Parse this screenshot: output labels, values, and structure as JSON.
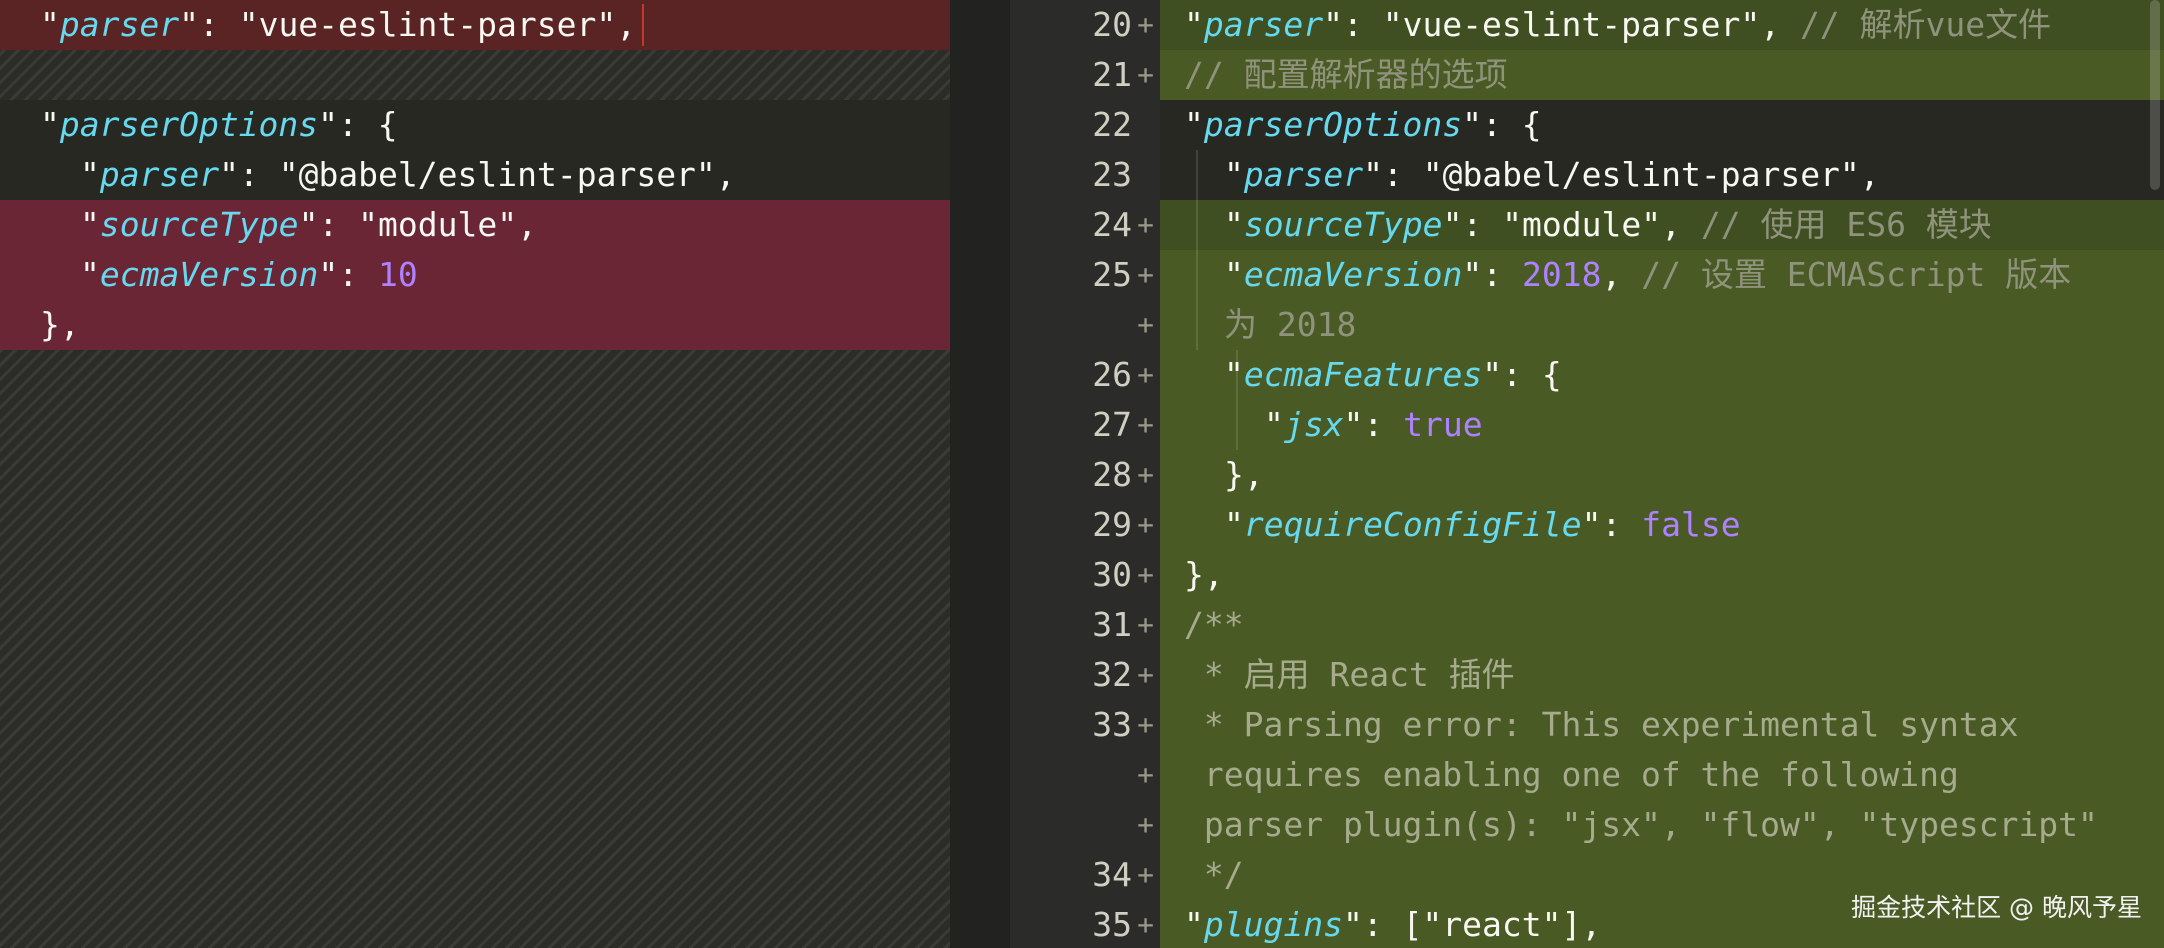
{
  "left": {
    "lines": [
      {
        "key": "parser",
        "value": "\"vue-eslint-parser\","
      },
      {
        "key": "parserOptions",
        "value": ": {"
      },
      {
        "key": "parser",
        "value": "\"@babel/eslint-parser\","
      },
      {
        "key": "sourceType",
        "value": "\"module\","
      },
      {
        "key": "ecmaVersion",
        "number": "10"
      },
      {
        "text": "},"
      }
    ]
  },
  "right": {
    "line_numbers": [
      "20",
      "21",
      "22",
      "23",
      "24",
      "25",
      "",
      "26",
      "27",
      "28",
      "29",
      "30",
      "31",
      "32",
      "33",
      "",
      "",
      "34",
      "35"
    ],
    "plus": "+",
    "code": {
      "l20_val": "\"vue-eslint-parser\",",
      "l20_comment": "// 解析vue文件",
      "l21_comment": "// 配置解析器的选项",
      "l22_open": ": {",
      "l23_val": "\"@babel/eslint-parser\",",
      "l24_val": "\"module\",",
      "l24_comment": "// 使用 ES6 模块",
      "l25_num": "2018",
      "l25_comment": "// 设置 ECMAScript 版本",
      "l25b_comment": "为 2018",
      "l26_open": ": {",
      "l27_bool": "true",
      "l28_close": "},",
      "l29_bool": "false",
      "l30_close": "},",
      "l31_comment": "/**",
      "l32_comment": " * 启用 React 插件",
      "l33_comment": " * Parsing error: This experimental syntax",
      "l33b_comment": " requires enabling one of the following",
      "l33c_comment": " parser plugin(s): \"jsx\", \"flow\", \"typescript\"",
      "l34_comment": " */",
      "l35_val": "[\"react\"],"
    },
    "keys": {
      "parser": "parser",
      "parserOptions": "parserOptions",
      "sourceType": "sourceType",
      "ecmaVersion": "ecmaVersion",
      "ecmaFeatures": "ecmaFeatures",
      "jsx": "jsx",
      "requireConfigFile": "requireConfigFile",
      "plugins": "plugins"
    }
  },
  "watermark": "掘金技术社区 @ 晚风予星",
  "colors": {
    "deleted_bg": "#6b2636",
    "added_bg": "#4a5a24",
    "key": "#66d9ef",
    "number": "#ae81ff",
    "comment": "#8f937c"
  }
}
